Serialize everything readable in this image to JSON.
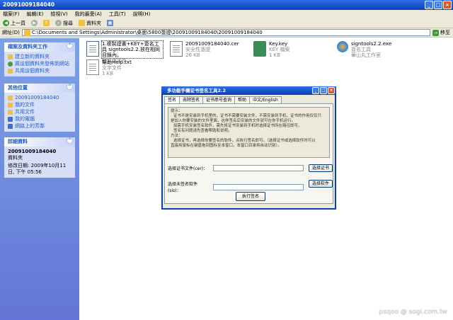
{
  "window": {
    "title": "20091009184040"
  },
  "menu": [
    "檔案(F)",
    "編輯(E)",
    "檢視(V)",
    "我的最愛(A)",
    "工具(T)",
    "說明(H)"
  ],
  "toolbar": {
    "back": "上一頁",
    "search": "搜尋",
    "folders": "資料夾"
  },
  "address": {
    "label": "網址(D)",
    "value": "C:\\Documents and Settings\\Administrator\\桌面\\5800簽證\\20091009184040\\20091009184040",
    "go": "移至"
  },
  "sidebar": {
    "tasks": {
      "title": "檔案及資料夾工作",
      "items": [
        "建立新的資料夾",
        "將這個資料夾發佈到網站",
        "共用這個資料夾"
      ]
    },
    "places": {
      "title": "其他位置",
      "items": [
        "20091009184040",
        "我的文件",
        "共用文件",
        "我的電腦",
        "網路上的芳鄰"
      ]
    },
    "details": {
      "title": "詳細資料",
      "name": "20091009184040",
      "type": "資料夾",
      "modified": "修改日期: 2009年10月11日, 下午 05:56"
    }
  },
  "files": [
    {
      "name": "1.複製證書+KEY+簽名工具 signtools2.2.放在相同目錄內。",
      "type": "純文字文件",
      "size": ""
    },
    {
      "name": "20091009184040.cer",
      "type": "安全性憑證",
      "size": "26 KB"
    },
    {
      "name": "Key.key",
      "type": "KEY 檔案",
      "size": "1 KB"
    },
    {
      "name": "signtools2.2.exe",
      "type": "簽名工具",
      "size": "華山丸工作室"
    },
    {
      "name": "幫助Help.txt",
      "type": "文字文件",
      "size": "1 KB"
    }
  ],
  "dialog": {
    "title": "多功能手機证书签名工具2.2",
    "tabs": [
      "签名",
      "去除签名",
      "证书串号查询",
      "帮助",
      "中文/English"
    ],
    "hint": [
      "提示：",
      "证书不是安装到手机里的，证书不需要安装文件，不需安装到手机，证书的作用仅仅只",
      "是加入你要安装的文件里面，这样签名后安装的文件就可在你手机运行。",
      "如需手机安装签名软件，需先将证书安装到手机时选择证书所在路径即可。",
      "签名有问题请先查看帮助和说明。",
      "方法：",
      "选择证书，再选择你要签名的软件，点执行签名即可。（选择证书或选择软件时可以",
      "直接用鼠标在键盘拖到图标至本窗口，本窗口目录将自动识别）。"
    ],
    "cert_label": "选择证书文件(cer)：",
    "cert_btn": "选择证书",
    "sis_label": "选择未签名软件(sis)：",
    "sis_btn": "选择软件",
    "run_btn": "执行签名"
  },
  "watermark": "pxqoo @ sogi.com.tw"
}
